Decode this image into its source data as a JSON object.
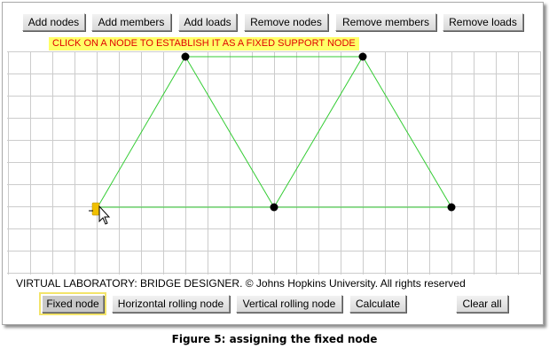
{
  "toolbar": {
    "add_nodes": "Add nodes",
    "add_members": "Add members",
    "add_loads": "Add loads",
    "remove_nodes": "Remove nodes",
    "remove_members": "Remove members",
    "remove_loads": "Remove loads"
  },
  "instruction": "CLICK ON A NODE TO ESTABLISH IT AS A FIXED SUPPORT NODE",
  "copyright": "VIRTUAL LABORATORY: BRIDGE DESIGNER. © Johns Hopkins University. All rights reserved",
  "support_buttons": {
    "fixed": "Fixed node",
    "horizontal_rolling": "Horizontal rolling node",
    "vertical_rolling": "Vertical rolling node",
    "calculate": "Calculate",
    "clear_all": "Clear all"
  },
  "caption": "Figure 5: assigning the fixed node",
  "colors": {
    "member": "#33cc33",
    "node": "#000000",
    "fixed_marker": "#f0c000",
    "grid": "#cccccc",
    "instruction_bg": "#ffff66",
    "instruction_text": "#e00000"
  },
  "icons": [
    "mouse-pointer-icon"
  ]
}
